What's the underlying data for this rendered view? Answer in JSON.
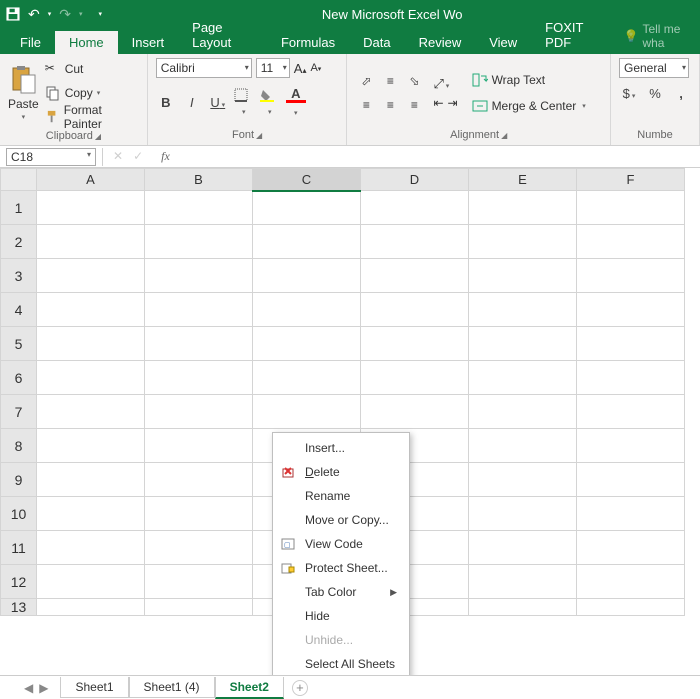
{
  "window": {
    "title": "New Microsoft Excel Wo"
  },
  "tabs": {
    "file": "File",
    "home": "Home",
    "insert": "Insert",
    "pagelayout": "Page Layout",
    "formulas": "Formulas",
    "data": "Data",
    "review": "Review",
    "view": "View",
    "foxit": "FOXIT PDF",
    "tellme": "Tell me wha"
  },
  "ribbon": {
    "clipboard": {
      "paste": "Paste",
      "cut": "Cut",
      "copy": "Copy",
      "formatpainter": "Format Painter",
      "label": "Clipboard"
    },
    "font": {
      "name": "Calibri",
      "size": "11",
      "label": "Font"
    },
    "alignment": {
      "wrap": "Wrap Text",
      "merge": "Merge & Center",
      "label": "Alignment"
    },
    "number": {
      "format": "General",
      "label": "Numbe"
    }
  },
  "namebox": "C18",
  "columns": [
    "A",
    "B",
    "C",
    "D",
    "E",
    "F"
  ],
  "rows": [
    "1",
    "2",
    "3",
    "4",
    "5",
    "6",
    "7",
    "8",
    "9",
    "10",
    "11",
    "12",
    "13"
  ],
  "sheets": {
    "s1": "Sheet1",
    "s2": "Sheet1 (4)",
    "s3": "Sheet2"
  },
  "ctx": {
    "insert": "Insert...",
    "delete": "Delete",
    "rename": "Rename",
    "move": "Move or Copy...",
    "viewcode": "View Code",
    "protect": "Protect Sheet...",
    "tabcolor": "Tab Color",
    "hide": "Hide",
    "unhide": "Unhide...",
    "selectall": "Select All Sheets"
  }
}
